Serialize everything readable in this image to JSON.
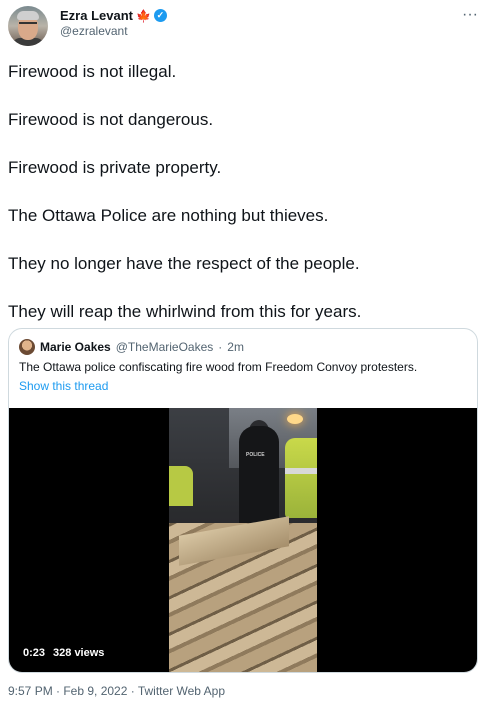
{
  "tweet": {
    "author": {
      "display_name": "Ezra Levant",
      "flag_emoji": "🍁",
      "verified": true,
      "handle": "@ezralevant"
    },
    "more_icon": "more-icon",
    "lines": [
      "Firewood is not illegal.",
      "Firewood is not dangerous.",
      "Firewood is private property.",
      "The Ottawa Police are nothing but thieves.",
      "They no longer have the respect of the people.",
      "They will reap the whirlwind from this for years."
    ],
    "quoted": {
      "display_name": "Marie Oakes",
      "handle": "@TheMarieOakes",
      "separator": "·",
      "time": "2m",
      "text": "The Ottawa police confiscating fire wood from Freedom Convoy protesters.",
      "show_thread": "Show this thread",
      "video": {
        "duration": "0:23",
        "views": "328 views"
      }
    },
    "footer": "9:57 PM · Feb 9, 2022 · Twitter Web App"
  },
  "colors": {
    "text": "#0f1419",
    "secondary": "#536471",
    "link": "#1d9bf0",
    "verified": "#1d9bf0",
    "border": "#cfd9de"
  }
}
